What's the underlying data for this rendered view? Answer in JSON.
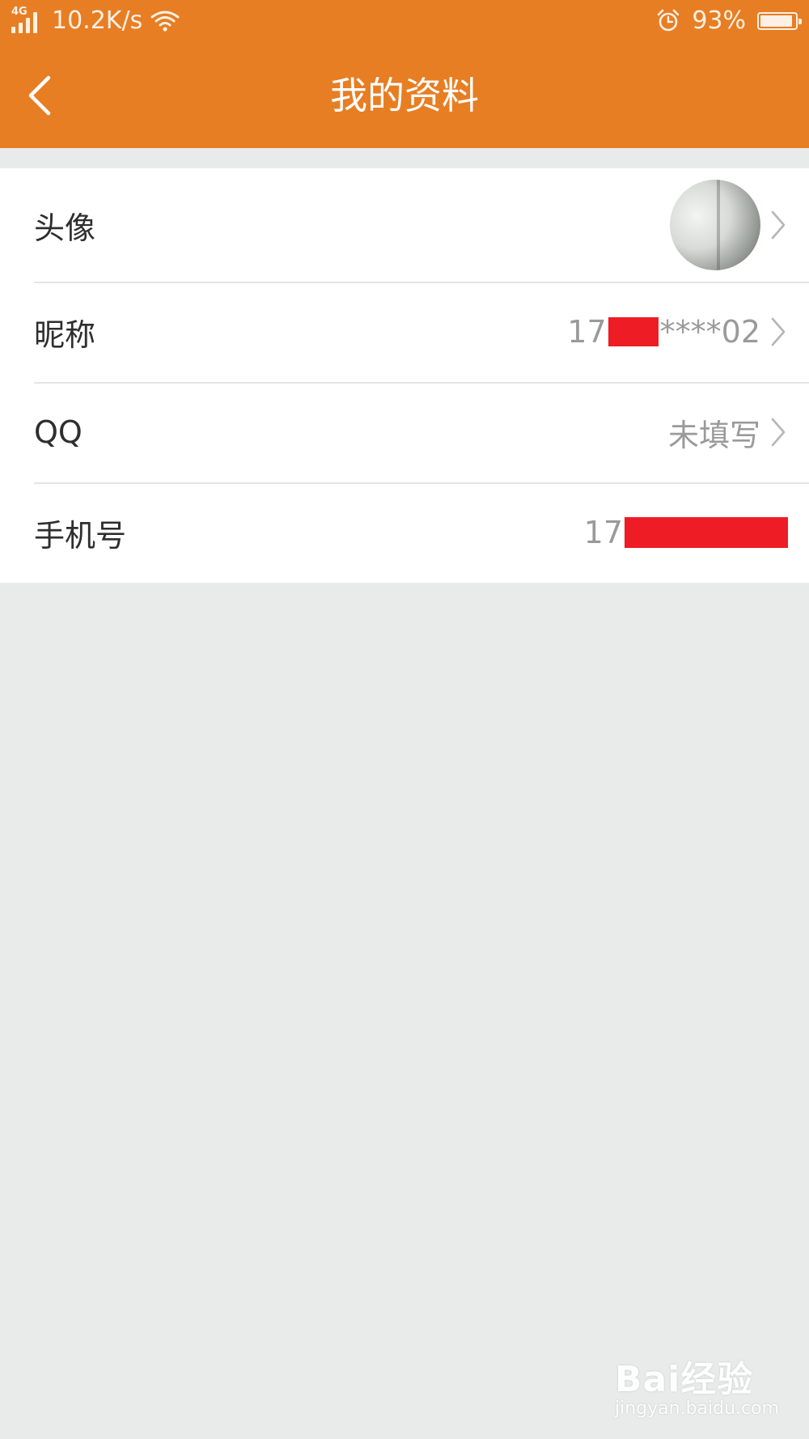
{
  "status_bar": {
    "network_type": "4G",
    "speed": "10.2K/s",
    "battery_percent": "93%",
    "battery_level": 0.93
  },
  "header": {
    "title": "我的资料",
    "background_color": "#e77e23"
  },
  "rows": {
    "avatar": {
      "label": "头像"
    },
    "nickname": {
      "label": "昵称",
      "value_prefix": "17",
      "value_suffix": "****02"
    },
    "qq": {
      "label": "QQ",
      "value": "未填写"
    },
    "phone": {
      "label": "手机号",
      "value_prefix": "17"
    }
  },
  "watermark": {
    "brand": "Bai经验",
    "url": "jingyan.baidu.com"
  },
  "colors": {
    "background": "#e9ebeb",
    "redaction": "#ee1c25"
  }
}
